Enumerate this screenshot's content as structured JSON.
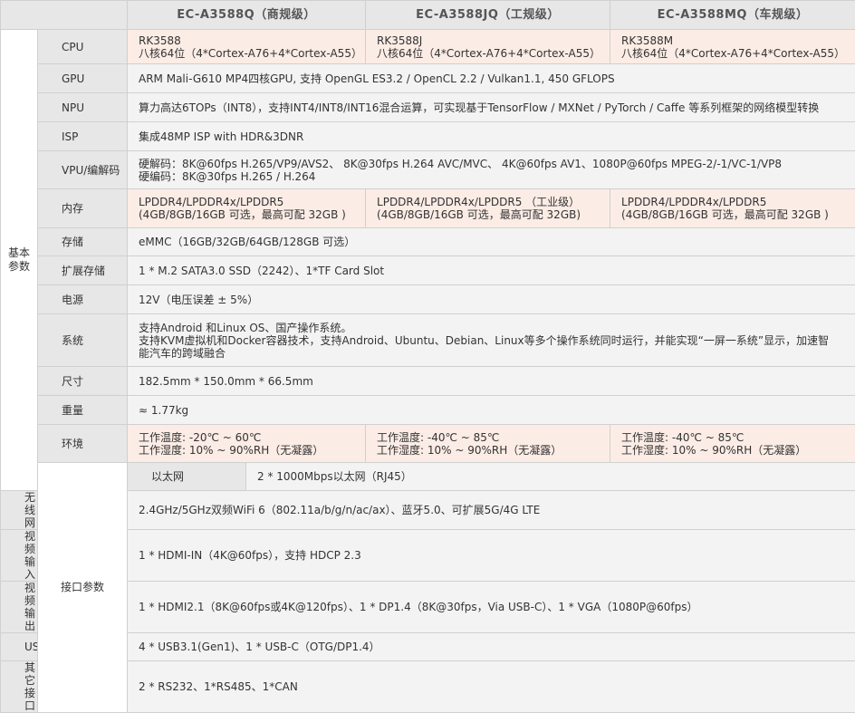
{
  "header": {
    "col1": "EC-A3588Q（商规级）",
    "col2": "EC-A3588JQ（工规级）",
    "col3": "EC-A3588MQ（车规级）"
  },
  "categories": {
    "basic": "基本参数",
    "interface": "接口参数"
  },
  "rows": {
    "cpu": {
      "label": "CPU",
      "q_l1": "RK3588",
      "q_l2": "八核64位（4*Cortex-A76+4*Cortex-A55）",
      "jq_l1": "RK3588J",
      "jq_l2": "八核64位（4*Cortex-A76+4*Cortex-A55）",
      "mq_l1": "RK3588M",
      "mq_l2": "八核64位（4*Cortex-A76+4*Cortex-A55）"
    },
    "gpu": {
      "label": "GPU",
      "value": "ARM Mali-G610 MP4四核GPU, 支持 OpenGL ES3.2 / OpenCL 2.2 / Vulkan1.1, 450 GFLOPS"
    },
    "npu": {
      "label": "NPU",
      "value": "算力高达6TOPs（INT8），支持INT4/INT8/INT16混合运算，可实现基于TensorFlow / MXNet / PyTorch / Caffe 等系列框架的网络模型转换"
    },
    "isp": {
      "label": "ISP",
      "value": "集成48MP ISP with HDR&3DNR"
    },
    "vpu": {
      "label": "VPU/编解码",
      "line1": "硬解码：8K@60fps H.265/VP9/AVS2、 8K@30fps H.264 AVC/MVC、 4K@60fps AV1、1080P@60fps MPEG-2/-1/VC-1/VP8",
      "line2": "硬编码：8K@30fps H.265 / H.264"
    },
    "memory": {
      "label": "内存",
      "q_l1": "LPDDR4/LPDDR4x/LPDDR5",
      "q_l2": "(4GB/8GB/16GB 可选，最高可配 32GB )",
      "jq_l1": "LPDDR4/LPDDR4x/LPDDR5 （工业级）",
      "jq_l2": "(4GB/8GB/16GB 可选，最高可配 32GB)",
      "mq_l1": "LPDDR4/LPDDR4x/LPDDR5",
      "mq_l2": "(4GB/8GB/16GB 可选，最高可配 32GB )"
    },
    "storage": {
      "label": "存储",
      "value": "eMMC（16GB/32GB/64GB/128GB 可选）"
    },
    "expansion": {
      "label": "扩展存储",
      "value": "1 * M.2 SATA3.0 SSD（2242）、1*TF Card Slot"
    },
    "power": {
      "label": "电源",
      "value": "12V（电压误差 ± 5%）"
    },
    "system": {
      "label": "系统",
      "line1": "支持Android 和Linux OS、国产操作系统。",
      "line2": "支持KVM虚拟机和Docker容器技术，支持Android、Ubuntu、Debian、Linux等多个操作系统同时运行，并能实现“一屏一系统”显示，加速智",
      "line3": "能汽车的跨域融合"
    },
    "size": {
      "label": "尺寸",
      "value": "182.5mm * 150.0mm * 66.5mm"
    },
    "weight": {
      "label": "重量",
      "value": "≈ 1.77kg"
    },
    "env": {
      "label": "环境",
      "q_l1": "工作温度: -20℃ ~ 60℃",
      "q_l2": "工作湿度: 10% ~ 90%RH（无凝露）",
      "jq_l1": "工作温度: -40℃ ~ 85℃",
      "jq_l2": "工作湿度: 10% ~ 90%RH（无凝露）",
      "mq_l1": "工作温度: -40℃ ~ 85℃",
      "mq_l2": "工作湿度: 10% ~ 90%RH（无凝露）"
    },
    "ethernet": {
      "label": "以太网",
      "value": "2 * 1000Mbps以太网（RJ45）"
    },
    "wireless": {
      "label": "无线网",
      "value": "2.4GHz/5GHz双频WiFi 6（802.11a/b/g/n/ac/ax）、蓝牙5.0、可扩展5G/4G LTE"
    },
    "video_in": {
      "label": "视频输入",
      "value": "1 * HDMI-IN（4K@60fps），支持 HDCP 2.3"
    },
    "video_out": {
      "label": "视频输出",
      "value": "1 * HDMI2.1（8K@60fps或4K@120fps）、1 * DP1.4（8K@30fps，Via USB-C）、1 * VGA（1080P@60fps）"
    },
    "usb": {
      "label": "USB",
      "value": "4 * USB3.1(Gen1)、1 * USB-C（OTG/DP1.4）"
    },
    "other": {
      "label": "其它接口",
      "value": "2 * RS232、1*RS485、1*CAN"
    }
  }
}
